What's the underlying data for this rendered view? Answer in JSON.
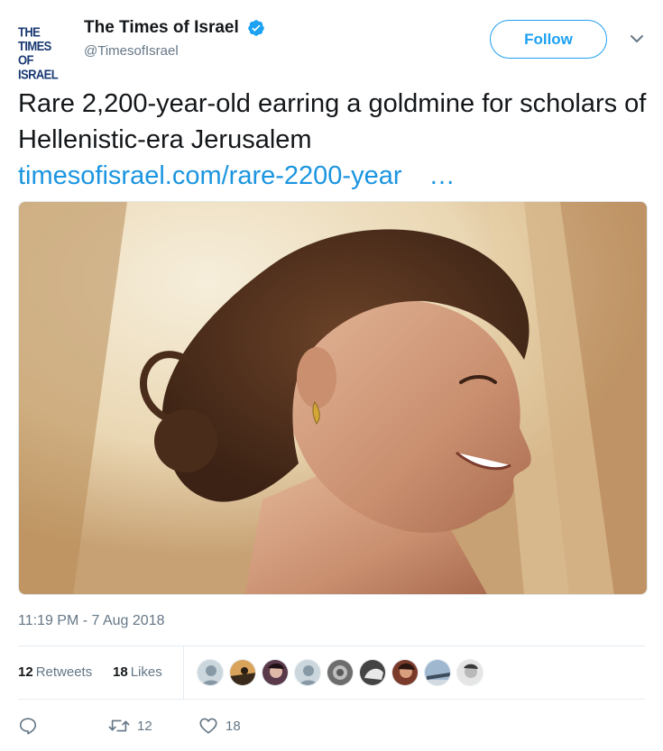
{
  "account": {
    "logo_line1": "THE TIMES",
    "logo_line2": "OF ISRAEL",
    "display_name": "The Times of Israel",
    "handle": "@TimesofIsrael",
    "verified": true
  },
  "header": {
    "follow_label": "Follow"
  },
  "tweet": {
    "text": "Rare 2,200-year-old earring a goldmine for scholars of Hellenistic-era Jerusalem",
    "link_text": "timesofisrael.com/rare-2200-year",
    "link_ellipsis": "…",
    "timestamp": "11:19 PM - 7 Aug 2018"
  },
  "stats": {
    "retweets_count": "12",
    "retweets_label": "Retweets",
    "likes_count": "18",
    "likes_label": "Likes"
  },
  "actions": {
    "retweet_count": "12",
    "like_count": "18"
  },
  "colors": {
    "accent": "#1da1f2",
    "link": "#1b95e0",
    "muted": "#657786",
    "logo": "#1a3a73"
  },
  "icons": {
    "reply": "reply-icon",
    "retweet": "retweet-icon",
    "like": "heart-icon",
    "more": "chevron-down-icon",
    "verified": "verified-badge-icon"
  }
}
